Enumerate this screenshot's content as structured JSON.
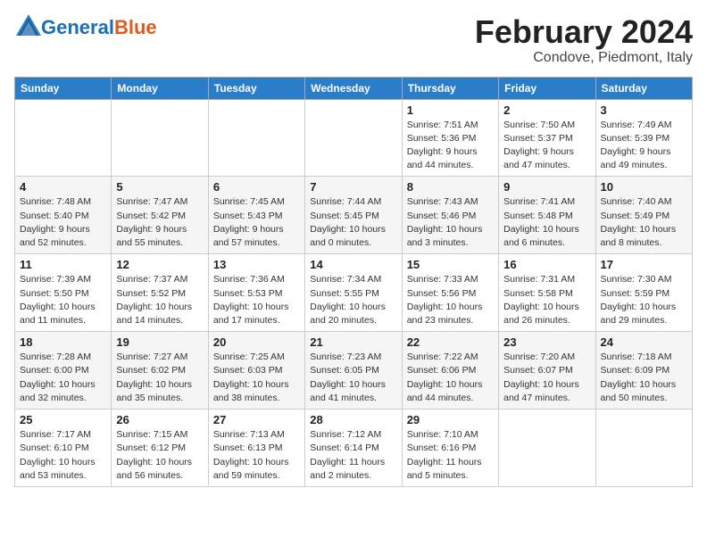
{
  "header": {
    "logo_main": "General",
    "logo_sub": "Blue",
    "month_title": "February 2024",
    "location": "Condove, Piedmont, Italy"
  },
  "columns": [
    "Sunday",
    "Monday",
    "Tuesday",
    "Wednesday",
    "Thursday",
    "Friday",
    "Saturday"
  ],
  "weeks": [
    [
      {
        "day": "",
        "info": ""
      },
      {
        "day": "",
        "info": ""
      },
      {
        "day": "",
        "info": ""
      },
      {
        "day": "",
        "info": ""
      },
      {
        "day": "1",
        "info": "Sunrise: 7:51 AM\nSunset: 5:36 PM\nDaylight: 9 hours\nand 44 minutes."
      },
      {
        "day": "2",
        "info": "Sunrise: 7:50 AM\nSunset: 5:37 PM\nDaylight: 9 hours\nand 47 minutes."
      },
      {
        "day": "3",
        "info": "Sunrise: 7:49 AM\nSunset: 5:39 PM\nDaylight: 9 hours\nand 49 minutes."
      }
    ],
    [
      {
        "day": "4",
        "info": "Sunrise: 7:48 AM\nSunset: 5:40 PM\nDaylight: 9 hours\nand 52 minutes."
      },
      {
        "day": "5",
        "info": "Sunrise: 7:47 AM\nSunset: 5:42 PM\nDaylight: 9 hours\nand 55 minutes."
      },
      {
        "day": "6",
        "info": "Sunrise: 7:45 AM\nSunset: 5:43 PM\nDaylight: 9 hours\nand 57 minutes."
      },
      {
        "day": "7",
        "info": "Sunrise: 7:44 AM\nSunset: 5:45 PM\nDaylight: 10 hours\nand 0 minutes."
      },
      {
        "day": "8",
        "info": "Sunrise: 7:43 AM\nSunset: 5:46 PM\nDaylight: 10 hours\nand 3 minutes."
      },
      {
        "day": "9",
        "info": "Sunrise: 7:41 AM\nSunset: 5:48 PM\nDaylight: 10 hours\nand 6 minutes."
      },
      {
        "day": "10",
        "info": "Sunrise: 7:40 AM\nSunset: 5:49 PM\nDaylight: 10 hours\nand 8 minutes."
      }
    ],
    [
      {
        "day": "11",
        "info": "Sunrise: 7:39 AM\nSunset: 5:50 PM\nDaylight: 10 hours\nand 11 minutes."
      },
      {
        "day": "12",
        "info": "Sunrise: 7:37 AM\nSunset: 5:52 PM\nDaylight: 10 hours\nand 14 minutes."
      },
      {
        "day": "13",
        "info": "Sunrise: 7:36 AM\nSunset: 5:53 PM\nDaylight: 10 hours\nand 17 minutes."
      },
      {
        "day": "14",
        "info": "Sunrise: 7:34 AM\nSunset: 5:55 PM\nDaylight: 10 hours\nand 20 minutes."
      },
      {
        "day": "15",
        "info": "Sunrise: 7:33 AM\nSunset: 5:56 PM\nDaylight: 10 hours\nand 23 minutes."
      },
      {
        "day": "16",
        "info": "Sunrise: 7:31 AM\nSunset: 5:58 PM\nDaylight: 10 hours\nand 26 minutes."
      },
      {
        "day": "17",
        "info": "Sunrise: 7:30 AM\nSunset: 5:59 PM\nDaylight: 10 hours\nand 29 minutes."
      }
    ],
    [
      {
        "day": "18",
        "info": "Sunrise: 7:28 AM\nSunset: 6:00 PM\nDaylight: 10 hours\nand 32 minutes."
      },
      {
        "day": "19",
        "info": "Sunrise: 7:27 AM\nSunset: 6:02 PM\nDaylight: 10 hours\nand 35 minutes."
      },
      {
        "day": "20",
        "info": "Sunrise: 7:25 AM\nSunset: 6:03 PM\nDaylight: 10 hours\nand 38 minutes."
      },
      {
        "day": "21",
        "info": "Sunrise: 7:23 AM\nSunset: 6:05 PM\nDaylight: 10 hours\nand 41 minutes."
      },
      {
        "day": "22",
        "info": "Sunrise: 7:22 AM\nSunset: 6:06 PM\nDaylight: 10 hours\nand 44 minutes."
      },
      {
        "day": "23",
        "info": "Sunrise: 7:20 AM\nSunset: 6:07 PM\nDaylight: 10 hours\nand 47 minutes."
      },
      {
        "day": "24",
        "info": "Sunrise: 7:18 AM\nSunset: 6:09 PM\nDaylight: 10 hours\nand 50 minutes."
      }
    ],
    [
      {
        "day": "25",
        "info": "Sunrise: 7:17 AM\nSunset: 6:10 PM\nDaylight: 10 hours\nand 53 minutes."
      },
      {
        "day": "26",
        "info": "Sunrise: 7:15 AM\nSunset: 6:12 PM\nDaylight: 10 hours\nand 56 minutes."
      },
      {
        "day": "27",
        "info": "Sunrise: 7:13 AM\nSunset: 6:13 PM\nDaylight: 10 hours\nand 59 minutes."
      },
      {
        "day": "28",
        "info": "Sunrise: 7:12 AM\nSunset: 6:14 PM\nDaylight: 11 hours\nand 2 minutes."
      },
      {
        "day": "29",
        "info": "Sunrise: 7:10 AM\nSunset: 6:16 PM\nDaylight: 11 hours\nand 5 minutes."
      },
      {
        "day": "",
        "info": ""
      },
      {
        "day": "",
        "info": ""
      }
    ]
  ]
}
